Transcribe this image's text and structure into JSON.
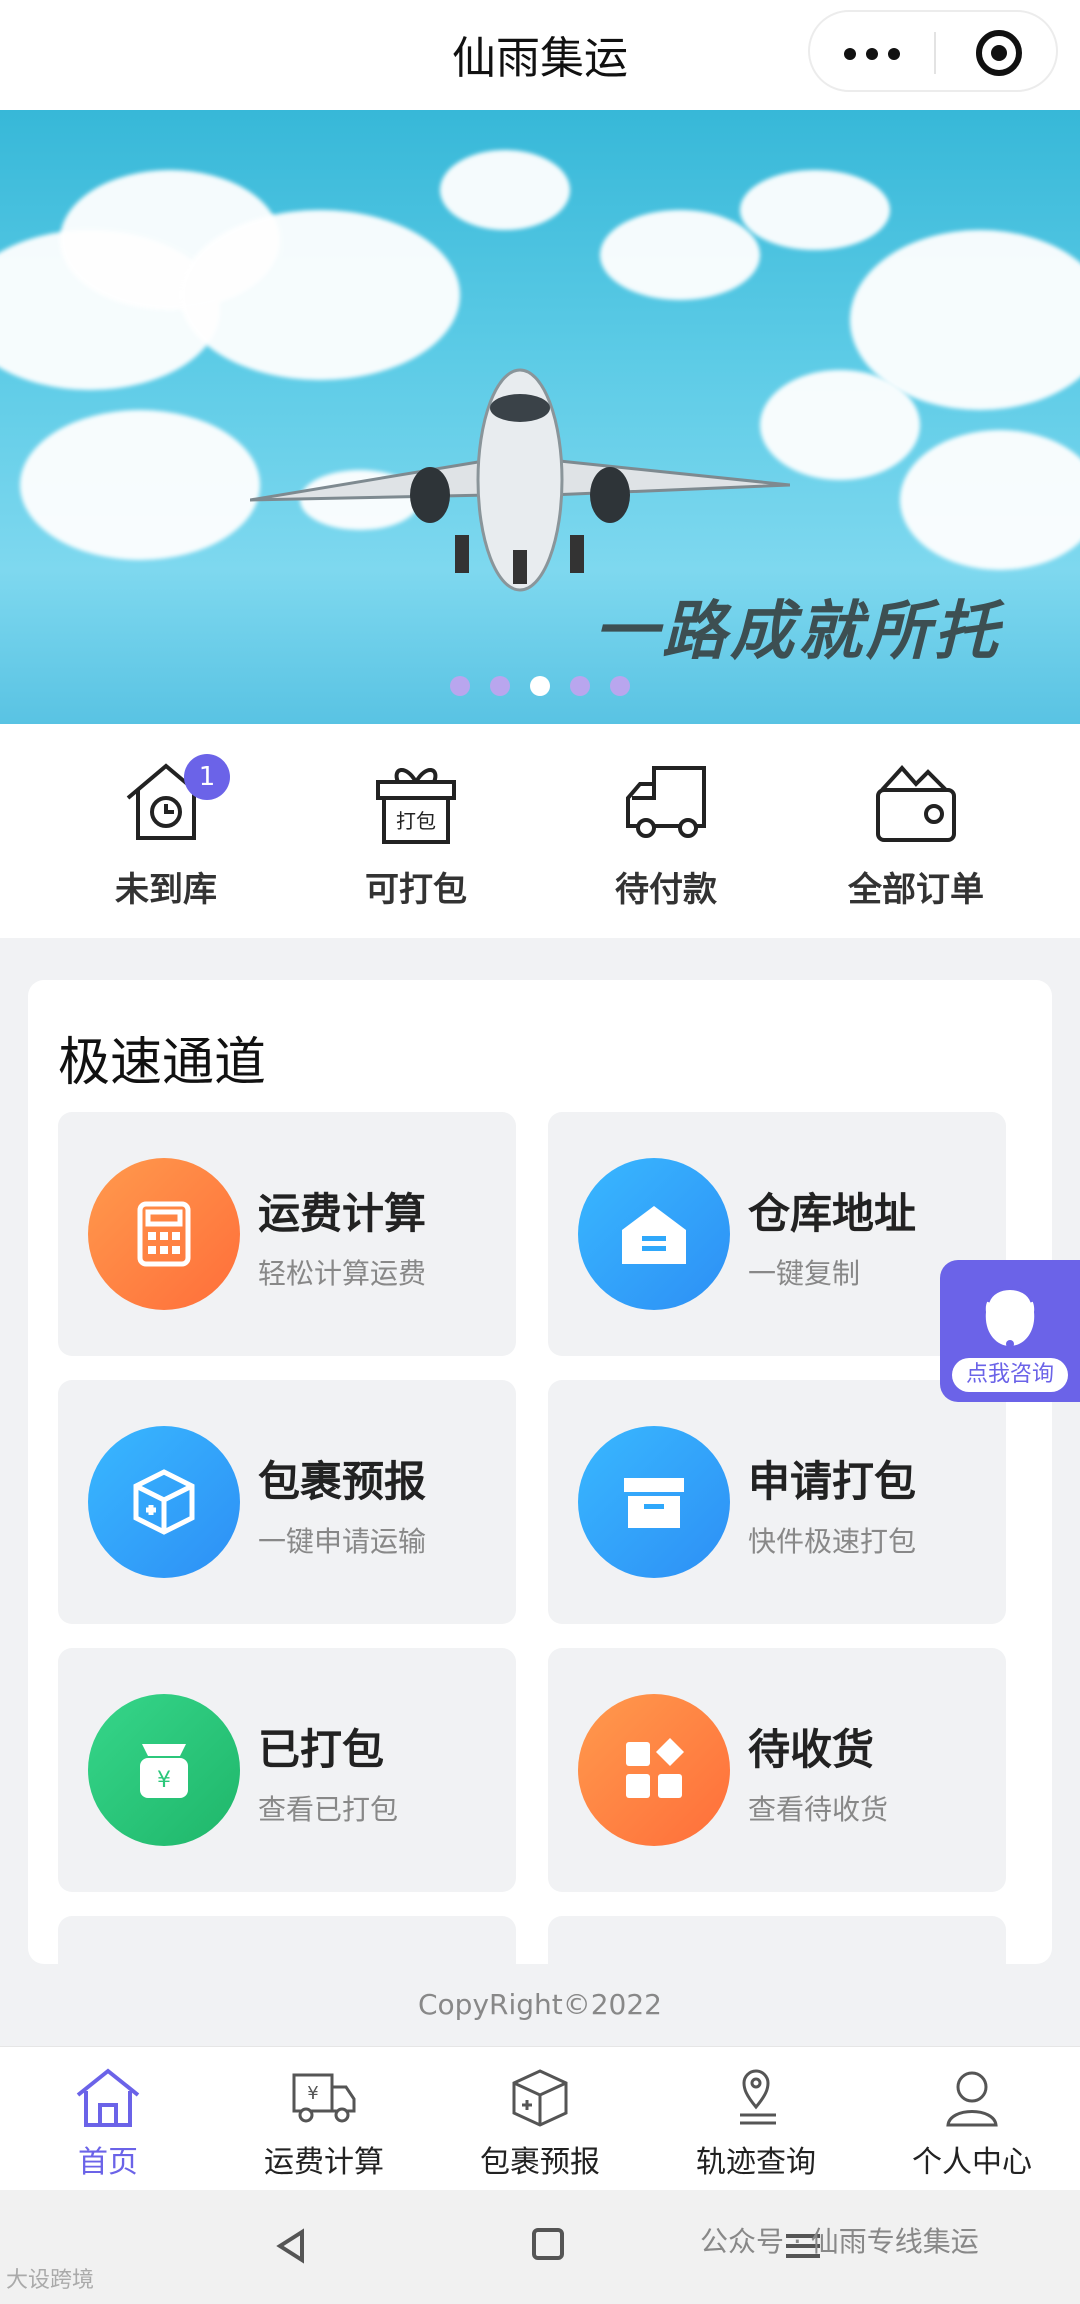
{
  "topbar": {
    "title": "仙雨集运"
  },
  "banner": {
    "slogan": "一路成就所托",
    "slides": 5,
    "active_slide": 3
  },
  "shortcuts": [
    {
      "label": "未到库",
      "icon": "house-clock-icon",
      "badge": "1"
    },
    {
      "label": "可打包",
      "icon": "gift-package-icon",
      "icon_text": "打包"
    },
    {
      "label": "待付款",
      "icon": "delivery-truck-icon"
    },
    {
      "label": "全部订单",
      "icon": "wallet-icon"
    }
  ],
  "fast_channel": {
    "title": "极速通道",
    "tiles": [
      {
        "title": "运费计算",
        "subtitle": "轻松计算运费",
        "icon": "calculator-icon",
        "color": "#ff7f3f"
      },
      {
        "title": "仓库地址",
        "subtitle": "一键复制",
        "icon": "warehouse-icon",
        "color": "#2fa8fb"
      },
      {
        "title": "包裹预报",
        "subtitle": "一键申请运输",
        "icon": "package-plus-icon",
        "color": "#2fa8fb"
      },
      {
        "title": "申请打包",
        "subtitle": "快件极速打包",
        "icon": "archive-box-icon",
        "color": "#2fa8fb"
      },
      {
        "title": "已打包",
        "subtitle": "查看已打包",
        "icon": "money-bag-icon",
        "color": "#2bc77a"
      },
      {
        "title": "待收货",
        "subtitle": "查看待收货",
        "icon": "grid-apps-icon",
        "color": "#ff7f3f"
      }
    ]
  },
  "consult": {
    "label": "点我咨询"
  },
  "footer": {
    "copyright": "CopyRight©2022"
  },
  "tabbar": [
    {
      "label": "首页",
      "icon": "home-icon",
      "active": true
    },
    {
      "label": "运费计算",
      "icon": "yen-truck-icon",
      "active": false
    },
    {
      "label": "包裹预报",
      "icon": "package-icon",
      "active": false
    },
    {
      "label": "轨迹查询",
      "icon": "location-pin-icon",
      "active": false
    },
    {
      "label": "个人中心",
      "icon": "user-icon",
      "active": false
    }
  ],
  "watermark": {
    "right": "公众号 · 仙雨专线集运",
    "left": "大设跨境"
  },
  "colors": {
    "accent": "#6b63e8",
    "orange": "#ff7f3f",
    "blue": "#2fa8fb",
    "green": "#2bc77a"
  }
}
